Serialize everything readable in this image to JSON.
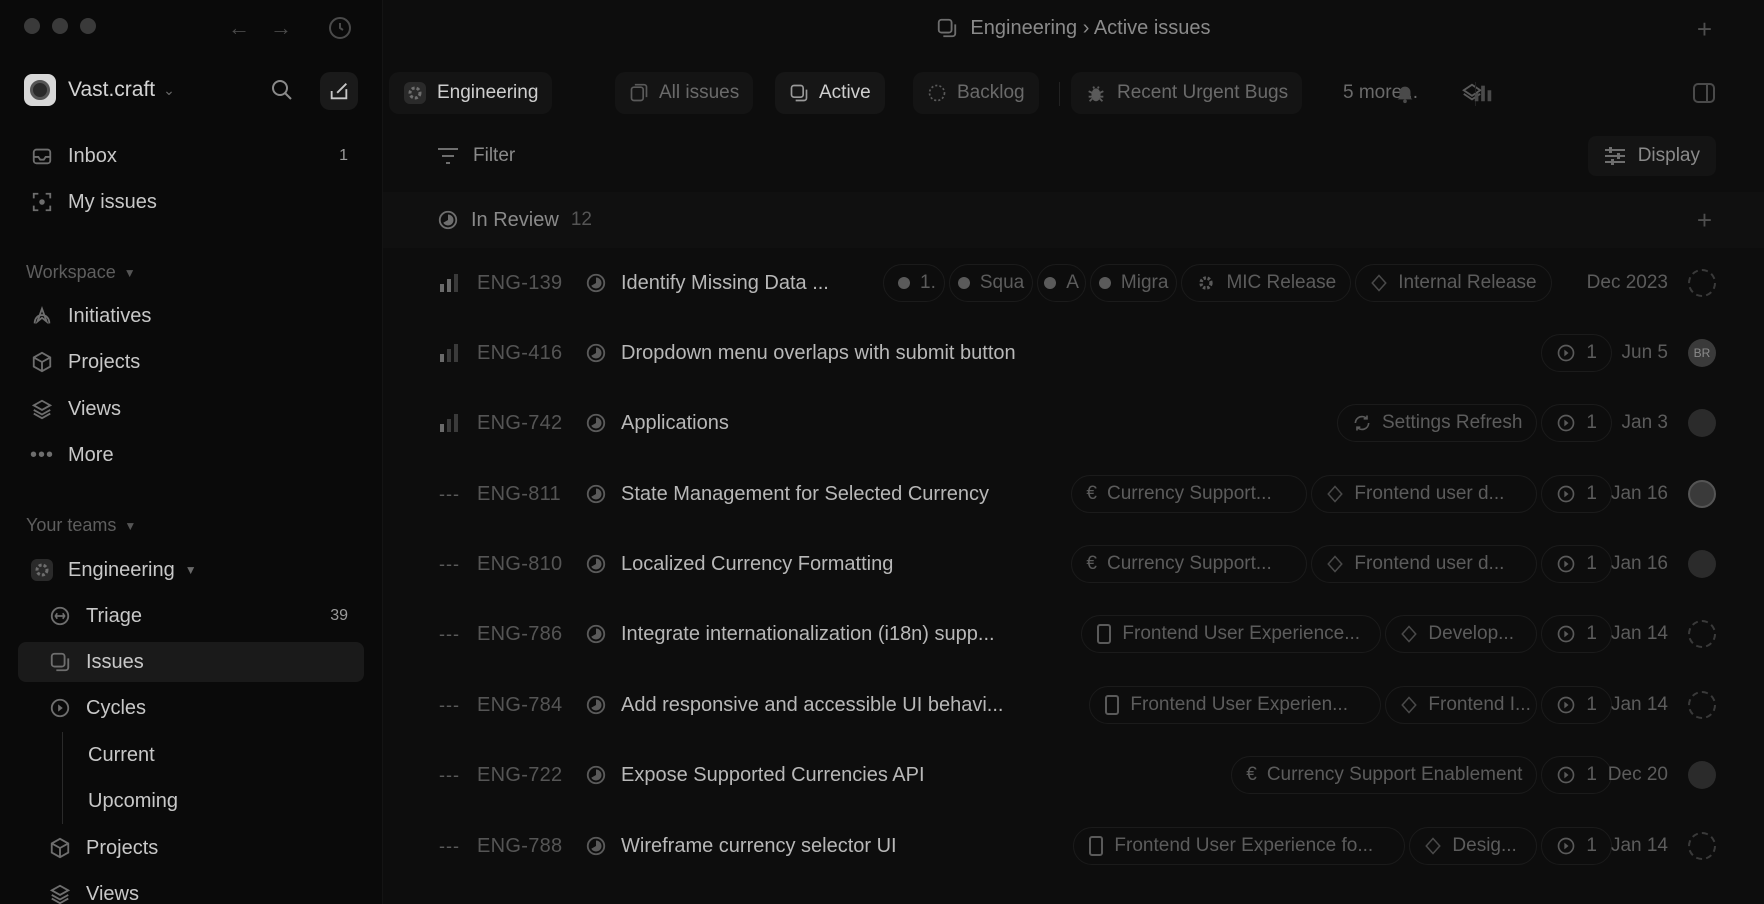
{
  "window": {
    "breadcrumb": "Engineering › Active issues"
  },
  "sidebar": {
    "workspace": "Vast.craft",
    "items": [
      {
        "label": "Inbox",
        "count": "1"
      },
      {
        "label": "My issues"
      }
    ],
    "workspace_section": "Workspace",
    "workspace_items": [
      {
        "label": "Initiatives"
      },
      {
        "label": "Projects"
      },
      {
        "label": "Views"
      },
      {
        "label": "More"
      }
    ],
    "teams_section": "Your teams",
    "team": {
      "name": "Engineering",
      "items": [
        {
          "label": "Triage",
          "count": "39"
        },
        {
          "label": "Issues"
        },
        {
          "label": "Cycles"
        },
        {
          "label": "Current"
        },
        {
          "label": "Upcoming"
        },
        {
          "label": "Projects"
        },
        {
          "label": "Views"
        }
      ]
    }
  },
  "tabs": {
    "team": "Engineering",
    "all": "All issues",
    "active": "Active",
    "backlog": "Backlog",
    "urgent": "Recent Urgent Bugs",
    "more": "5  more..."
  },
  "toolbar": {
    "filter": "Filter",
    "display": "Display"
  },
  "group": {
    "label": "In Review",
    "count": "12"
  },
  "issues": [
    {
      "id": "ENG-139",
      "title": "Identify Missing Data ...",
      "chips": [
        "1.",
        "Squa",
        "A",
        "Migra",
        "MIC Release",
        "Internal Release"
      ],
      "date": "Dec 2023"
    },
    {
      "id": "ENG-416",
      "title": "Dropdown menu overlaps with submit button",
      "chips": [
        "1"
      ],
      "date": "Jun 5",
      "avatar": "BR"
    },
    {
      "id": "ENG-742",
      "title": "Applications",
      "chips": [
        "Settings Refresh",
        "1"
      ],
      "date": "Jan 3"
    },
    {
      "id": "ENG-811",
      "title": "State Management for Selected Currency",
      "chips": [
        "Currency Support...",
        "Frontend user d...",
        "1"
      ],
      "date": "Jan 16"
    },
    {
      "id": "ENG-810",
      "title": "Localized Currency Formatting",
      "chips": [
        "Currency Support...",
        "Frontend user d...",
        "1"
      ],
      "date": "Jan 16"
    },
    {
      "id": "ENG-786",
      "title": "Integrate internationalization (i18n) supp...",
      "chips": [
        "Frontend User Experience...",
        "Develop...",
        "1"
      ],
      "date": "Jan 14"
    },
    {
      "id": "ENG-784",
      "title": "Add responsive and accessible UI behavi...",
      "chips": [
        "Frontend User Experien...",
        "Frontend I...",
        "1"
      ],
      "date": "Jan 14"
    },
    {
      "id": "ENG-722",
      "title": "Expose Supported Currencies API",
      "chips": [
        "Currency Support Enablement",
        "1"
      ],
      "date": "Dec 20"
    },
    {
      "id": "ENG-788",
      "title": "Wireframe currency selector UI",
      "chips": [
        "Frontend User Experience fo...",
        "Desig...",
        "1"
      ],
      "date": "Jan 14"
    }
  ]
}
